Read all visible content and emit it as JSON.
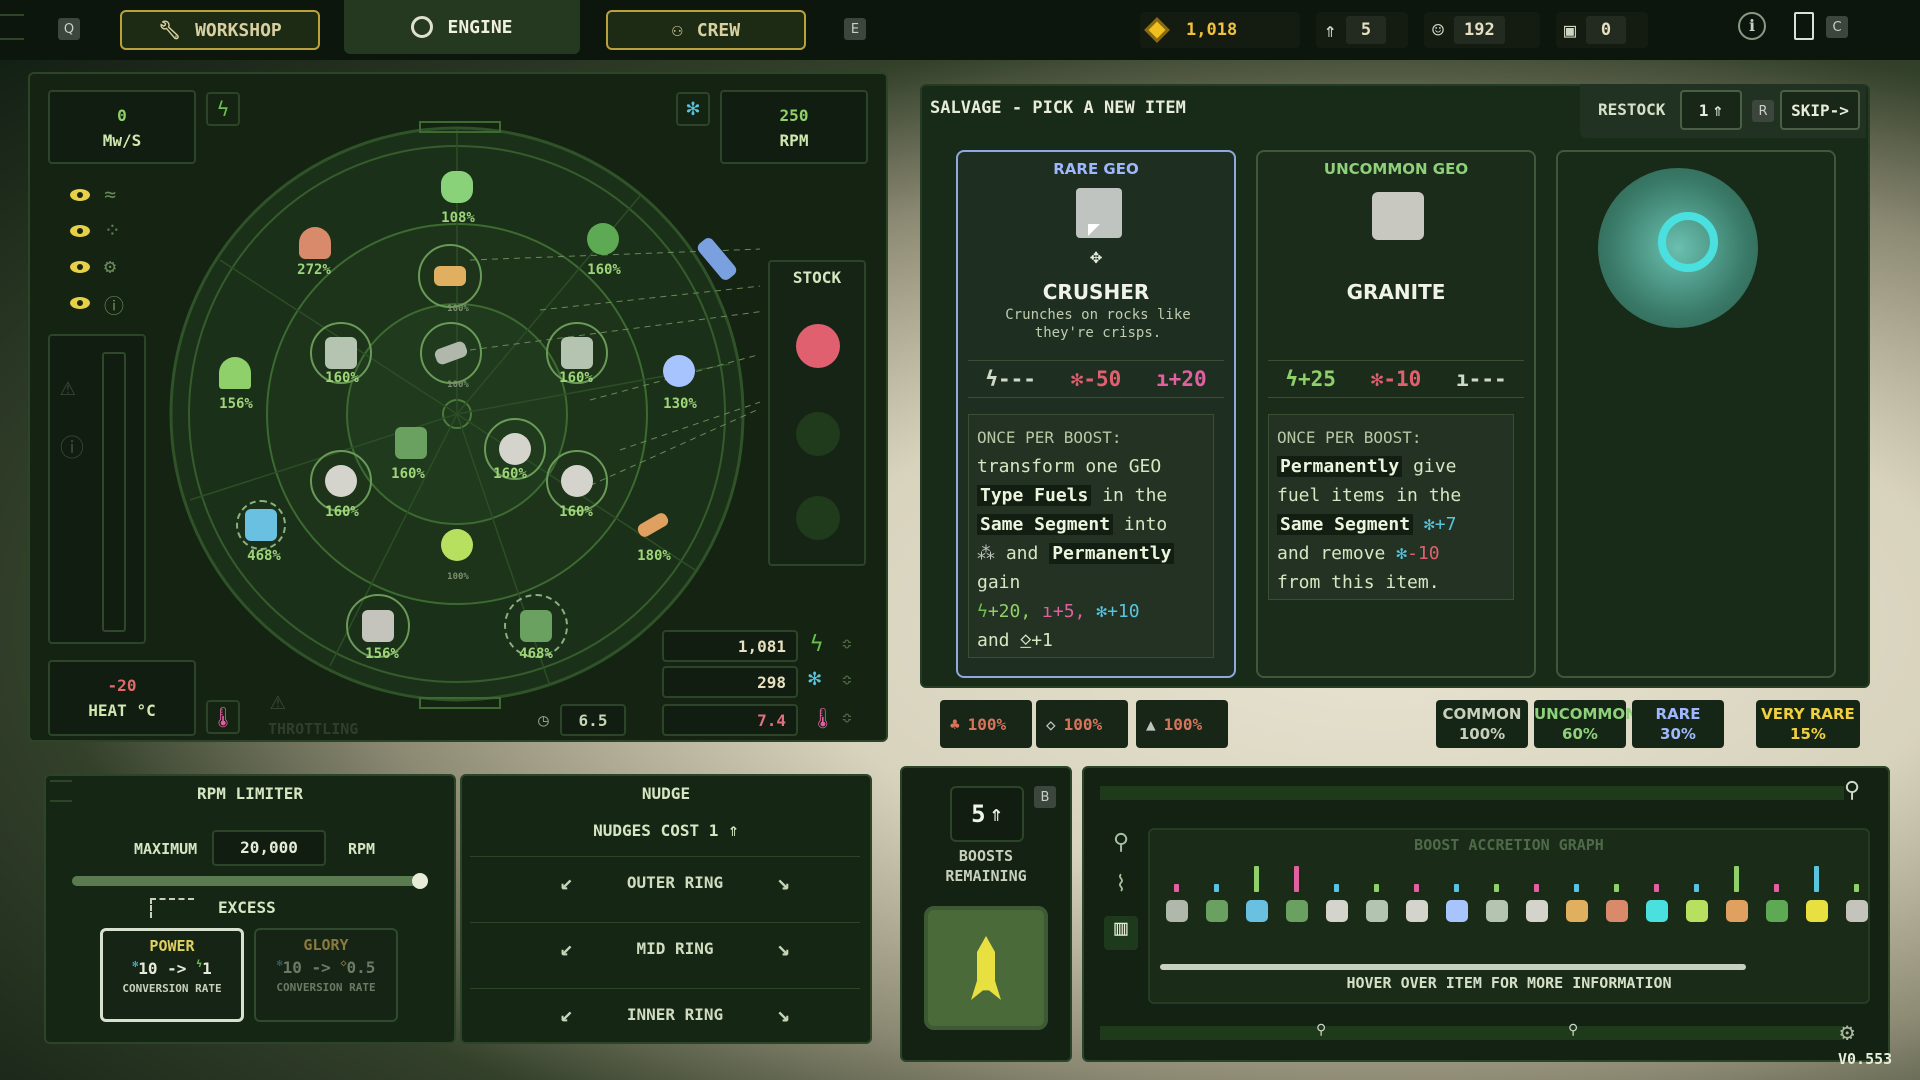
{
  "topbar": {
    "key_left": "Q",
    "tabs": [
      {
        "label": "WORKSHOP"
      },
      {
        "label": "ENGINE"
      },
      {
        "label": "CREW"
      }
    ],
    "key_right": "E",
    "resources": {
      "gold": "1,018",
      "boosts": "5",
      "crew": "192",
      "cargo": "0"
    },
    "key_c": "C"
  },
  "engine": {
    "power": {
      "value": "0",
      "unit": "Mw/S"
    },
    "rpm": {
      "value": "250",
      "unit": "RPM"
    },
    "stock_label": "STOCK",
    "heat": {
      "value": "-20",
      "unit": "HEAT °C"
    },
    "throttling_label": "THROTTLING",
    "speed_value": "6.5",
    "outputs": {
      "power": "1,081",
      "fuel": "298",
      "heat": "7.4"
    },
    "slot_pcts": {
      "s1": "108%",
      "s2": "272%",
      "s3": "160%",
      "s4": "156%",
      "s5": "130%",
      "s6": "160%",
      "s7": "160%",
      "s8": "160%",
      "s9": "160%",
      "s10": "160%",
      "s11": "160%",
      "s12": "468%",
      "s13": "180%",
      "s14": "156%",
      "s15": "468%",
      "s16": "100%",
      "s17": "100%",
      "s18": "100%"
    }
  },
  "salvage": {
    "title": "SALVAGE - PICK A NEW ITEM",
    "restock_label": "RESTOCK",
    "restock_cost": "1",
    "restock_key": "R",
    "skip_label": "SKIP->",
    "cards": [
      {
        "rarity": "RARE GEO",
        "name": "CRUSHER",
        "flavor": "Crunches on rocks like they're crisps.",
        "power": "---",
        "fuel": "-50",
        "heat": "+20",
        "desc_head": "ONCE PER BOOST:",
        "d1": "transform one GEO",
        "d2": "Type Fuels",
        "d3": "in the",
        "d4": "Same Segment",
        "d5": "into",
        "d6": "and",
        "d7": "Permanently",
        "d8": "gain",
        "g1": "+20,",
        "g2": "+5,",
        "g3": "+10",
        "d9": "and",
        "g4": "+1"
      },
      {
        "rarity": "UNCOMMON GEO",
        "name": "GRANITE",
        "power": "+25",
        "fuel": "-10",
        "heat": "---",
        "desc_head": "ONCE PER BOOST:",
        "d1": "Permanently",
        "d2": "give",
        "d3": "fuel items in the",
        "d4": "Same Segment",
        "g1": "+7",
        "d5": "and remove",
        "g2": "-10",
        "d6": "from this item."
      }
    ],
    "chips": [
      "100%",
      "100%",
      "100%"
    ],
    "rarities": [
      {
        "label": "COMMON",
        "value": "100%"
      },
      {
        "label": "UNCOMMON",
        "value": "60%"
      },
      {
        "label": "RARE",
        "value": "30%"
      },
      {
        "label": "VERY RARE",
        "value": "15%"
      }
    ]
  },
  "rpm_limiter": {
    "title": "RPM LIMITER",
    "max_label": "MAXIMUM",
    "max_value": "20,000",
    "unit": "RPM",
    "slider_level": 1.0,
    "excess_label": "EXCESS",
    "power_box": {
      "title": "POWER",
      "from": "10",
      "arrow": "->",
      "to": "1",
      "caption": "CONVERSION RATE"
    },
    "glory_box": {
      "title": "GLORY",
      "from": "10",
      "arrow": "->",
      "to": "0.5",
      "caption": "CONVERSION RATE"
    }
  },
  "nudge": {
    "title": "NUDGE",
    "cost_label": "NUDGES COST 1",
    "rings": [
      {
        "label": "OUTER RING"
      },
      {
        "label": "MID RING"
      },
      {
        "label": "INNER RING"
      }
    ]
  },
  "boosts": {
    "count": "5",
    "key": "B",
    "label1": "BOOSTS",
    "label2": "REMAINING"
  },
  "graph": {
    "title": "BOOST ACCRETION GRAPH",
    "hint": "HOVER OVER ITEM FOR MORE INFORMATION"
  },
  "version": "V0.553",
  "colors": {
    "accent_yellow": "#b9a23a",
    "power_green": "#8fd06a",
    "fuel_red": "#e06070",
    "heat_pink": "#e060a0",
    "rare_blue": "#9fb7ff",
    "uncommon_green": "#8fd07a"
  }
}
